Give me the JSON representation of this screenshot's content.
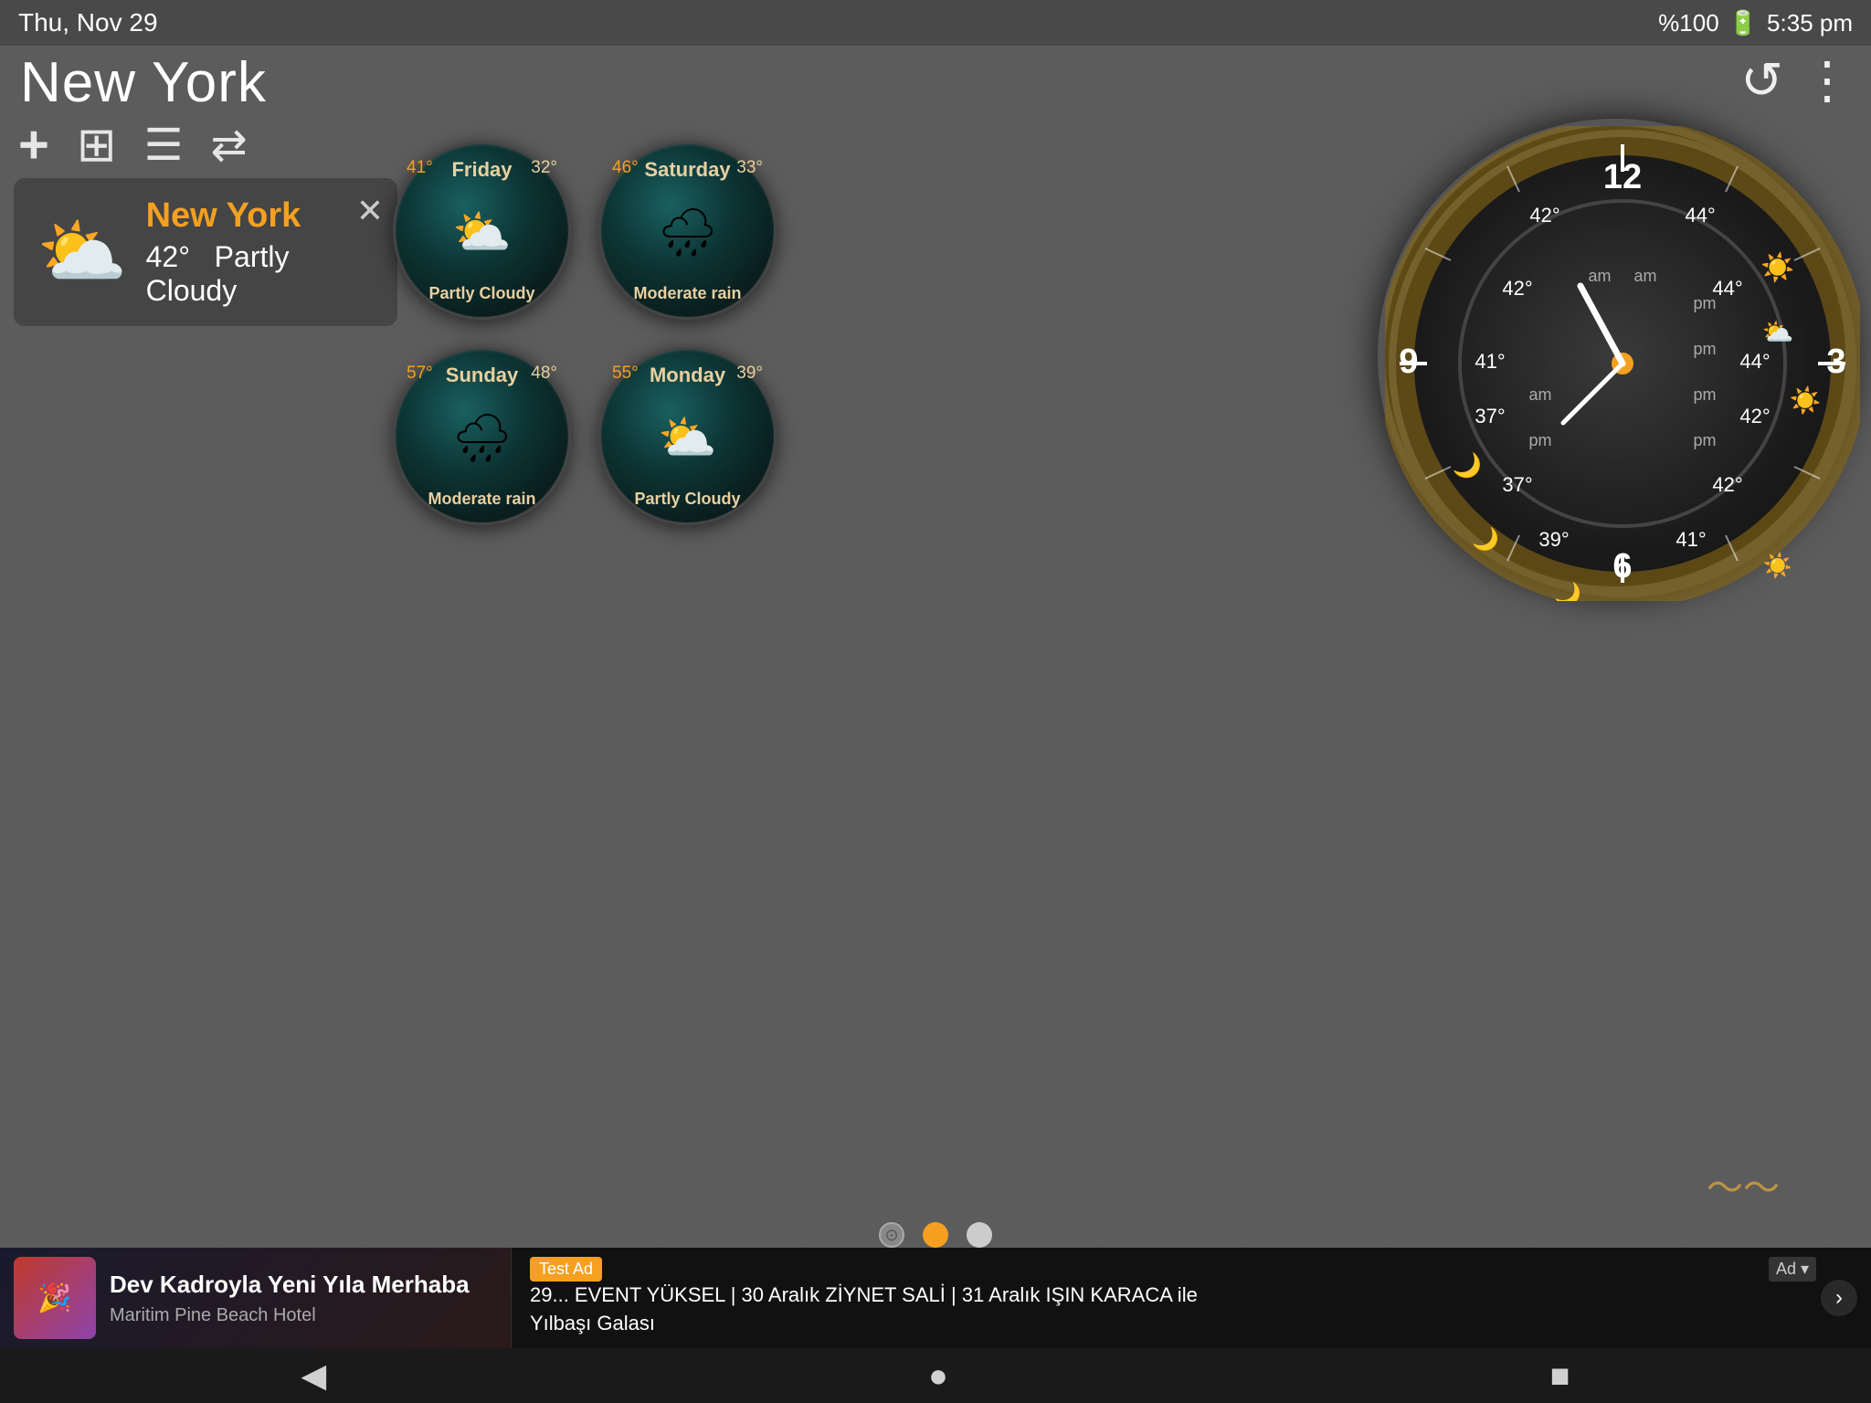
{
  "statusBar": {
    "date": "Thu, Nov 29",
    "time": "5:35 pm",
    "battery": "%100"
  },
  "cityTitle": "New York",
  "toolbar": {
    "addBtn": "+",
    "gridBtn": "⊞",
    "listBtn": "☰",
    "refreshBtn": "⇄"
  },
  "topButtons": {
    "refresh": "↺",
    "menu": "⋮"
  },
  "currentWeather": {
    "city": "New York",
    "temp": "42°",
    "condition": "Partly Cloudy"
  },
  "forecast": [
    {
      "day": "Friday",
      "high": "41°",
      "low": "32°",
      "condition": "Partly Cloudy",
      "icon": "⛅"
    },
    {
      "day": "Saturday",
      "high": "46°",
      "low": "33°",
      "condition": "Moderate rain",
      "icon": "🌧"
    },
    {
      "day": "Sunday",
      "high": "57°",
      "low": "48°",
      "condition": "Moderate rain",
      "icon": "🌧"
    },
    {
      "day": "Monday",
      "high": "55°",
      "low": "39°",
      "condition": "Partly Cloudy",
      "icon": "⛅"
    }
  ],
  "clock": {
    "hour": "5",
    "minute": "35",
    "tempPositions": {
      "top": "12",
      "right": "3",
      "bottom": "6",
      "left": "9"
    },
    "ringTemps": {
      "topLeft": "42°",
      "topRight": "44°",
      "midLeft": "42°",
      "midRight": "44°",
      "midLeft2": "41°",
      "midRight2": "44°",
      "lowerLeft": "37°",
      "lowerRight": "42°",
      "bottomLeft": "37°",
      "bottomRight": "42°",
      "belowLeft": "39°",
      "belowRight": "41°"
    }
  },
  "adBanner": {
    "left": {
      "thumbnail": "🎉",
      "mainText": "Dev Kadroyla Yeni Yıla Merhaba",
      "subText": "Maritim Pine Beach Hotel"
    },
    "right": {
      "badge": "Test Ad",
      "text": "29... EVENT YÜKSEL | 30 Aralık ZİYNET SALİ | 31 Aralık IŞIN KARACA ile\nYılbaşı Galası",
      "label": "Ad ▾"
    }
  },
  "pageIndicators": {
    "locationIcon": "⊙",
    "dots": [
      "active",
      "inactive"
    ]
  },
  "navBar": {
    "back": "◀",
    "home": "●",
    "square": "■"
  }
}
